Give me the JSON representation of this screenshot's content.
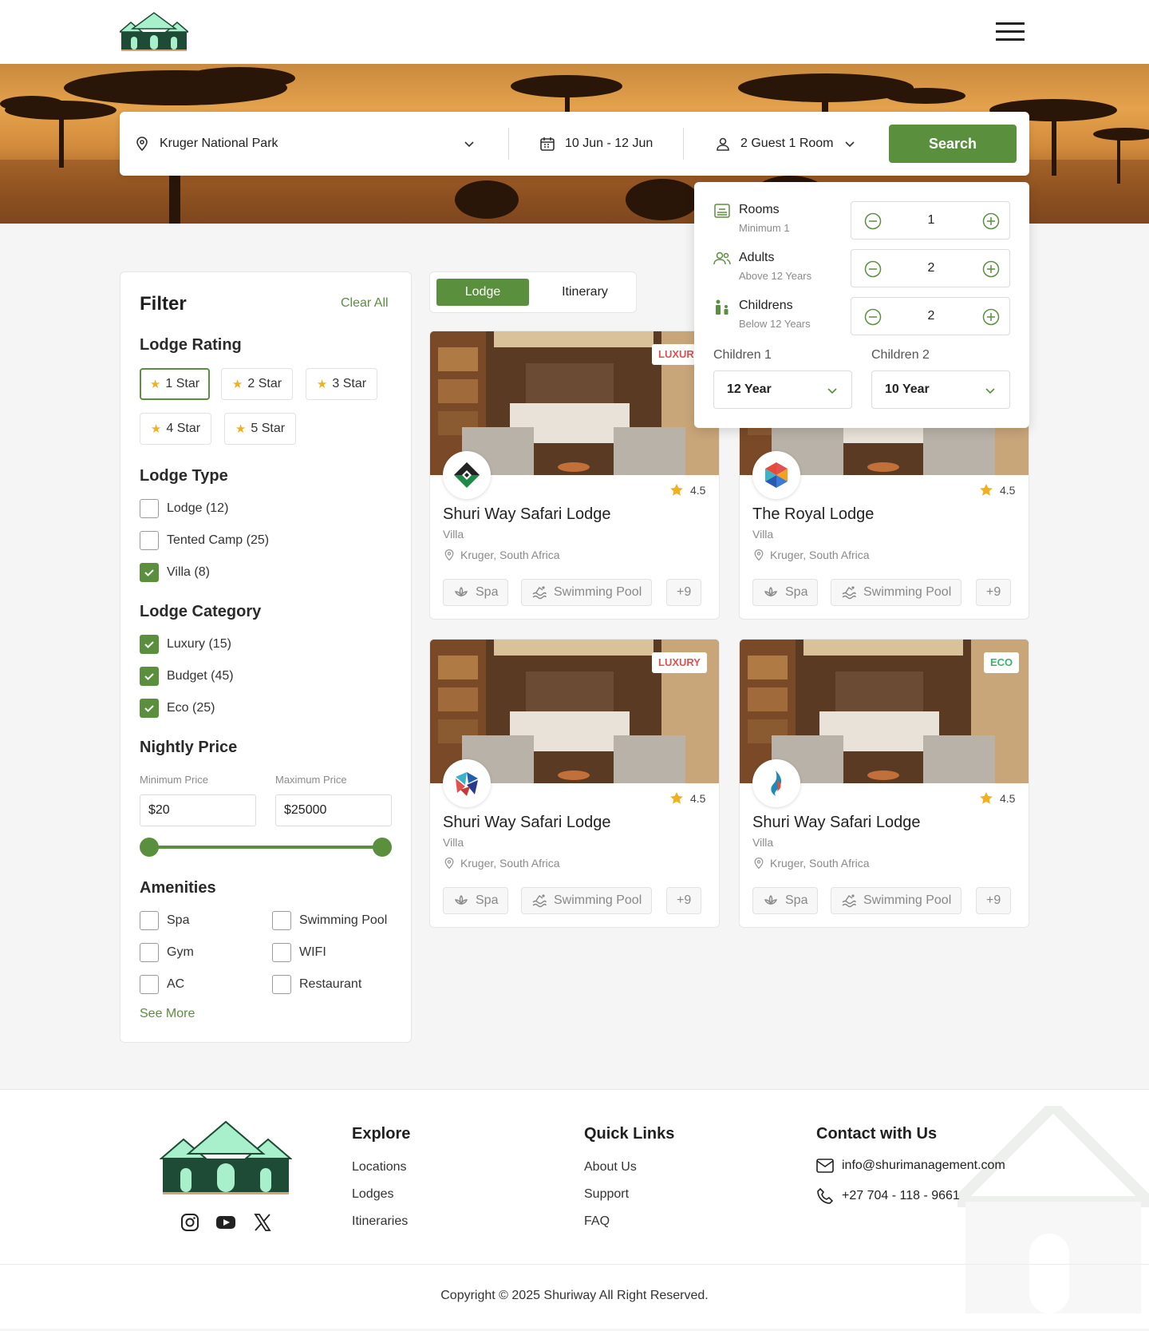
{
  "search": {
    "location": "Kruger National Park",
    "dates": "10 Jun - 12 Jun",
    "guests": "2 Guest 1 Room",
    "button": "Search"
  },
  "guest_popup": {
    "rooms": {
      "label": "Rooms",
      "sub": "Minimum 1",
      "value": "1"
    },
    "adults": {
      "label": "Adults",
      "sub": "Above 12 Years",
      "value": "2"
    },
    "children": {
      "label": "Childrens",
      "sub": "Below 12 Years",
      "value": "2"
    },
    "child1": {
      "label": "Children 1",
      "value": "12 Year"
    },
    "child2": {
      "label": "Children 2",
      "value": "10 Year"
    }
  },
  "filter": {
    "title": "Filter",
    "clear": "Clear All",
    "rating_title": "Lodge Rating",
    "ratings": [
      "1 Star",
      "2 Star",
      "3 Star",
      "4 Star",
      "5 Star"
    ],
    "active_rating": "1 Star",
    "type_title": "Lodge Type",
    "types": [
      {
        "label": "Lodge (12)",
        "checked": false
      },
      {
        "label": "Tented Camp (25)",
        "checked": false
      },
      {
        "label": "Villa (8)",
        "checked": true
      }
    ],
    "category_title": "Lodge Category",
    "categories": [
      {
        "label": "Luxury (15)",
        "checked": true
      },
      {
        "label": "Budget (45)",
        "checked": true
      },
      {
        "label": "Eco (25)",
        "checked": true
      }
    ],
    "price_title": "Nightly Price",
    "min_label": "Minimum Price",
    "max_label": "Maximum Price",
    "min_value": "$20",
    "max_value": "$25000",
    "amenities_title": "Amenities",
    "amenities": [
      {
        "label": "Spa",
        "checked": false
      },
      {
        "label": "Swimming Pool",
        "checked": false
      },
      {
        "label": "Gym",
        "checked": false
      },
      {
        "label": "WIFI",
        "checked": false
      },
      {
        "label": "AC",
        "checked": false
      },
      {
        "label": "Restaurant",
        "checked": false
      }
    ],
    "see_more": "See More"
  },
  "tabs": {
    "lodge": "Lodge",
    "itinerary": "Itinerary"
  },
  "cards": [
    {
      "name": "Shuri Way Safari Lodge",
      "type": "Villa",
      "location": "Kruger, South Africa",
      "rating": "4.5",
      "badge": "LUXURY",
      "amenity1": "Spa",
      "amenity2": "Swimming Pool",
      "more": "+9"
    },
    {
      "name": "The Royal Lodge",
      "type": "Villa",
      "location": "Kruger, South Africa",
      "rating": "4.5",
      "badge": "",
      "amenity1": "Spa",
      "amenity2": "Swimming Pool",
      "more": "+9"
    },
    {
      "name": "Shuri Way Safari Lodge",
      "type": "Villa",
      "location": "Kruger, South Africa",
      "rating": "4.5",
      "badge": "LUXURY",
      "amenity1": "Spa",
      "amenity2": "Swimming Pool",
      "more": "+9"
    },
    {
      "name": "Shuri Way Safari Lodge",
      "type": "Villa",
      "location": "Kruger, South Africa",
      "rating": "4.5",
      "badge": "ECO",
      "amenity1": "Spa",
      "amenity2": "Swimming Pool",
      "more": "+9"
    }
  ],
  "footer": {
    "explore_title": "Explore",
    "explore": [
      "Locations",
      "Lodges",
      "Itineraries"
    ],
    "quick_title": "Quick Links",
    "quick": [
      "About Us",
      "Support",
      "FAQ"
    ],
    "contact_title": "Contact with Us",
    "email": "info@shurimanagement.com",
    "phone": "+27 704 - 118 - 9661",
    "copyright": "Copyright © 2025 Shuriway All Right Reserved."
  },
  "colors": {
    "brand": "#5a8f3e",
    "star": "#f2b01e",
    "luxury": "#e0514f",
    "eco": "#3bb36c",
    "logo_mint": "#a8f0cc",
    "logo_dark": "#1d4b35"
  },
  "icons": [
    "menu-icon",
    "location-pin-icon",
    "calendar-icon",
    "user-icon",
    "chevron-down-icon",
    "bed-icon",
    "adults-icon",
    "child-icon",
    "minus-circle-icon",
    "plus-circle-icon",
    "star-icon",
    "check-icon",
    "spa-icon",
    "pool-icon",
    "instagram-icon",
    "youtube-icon",
    "x-icon",
    "mail-icon",
    "phone-icon"
  ]
}
